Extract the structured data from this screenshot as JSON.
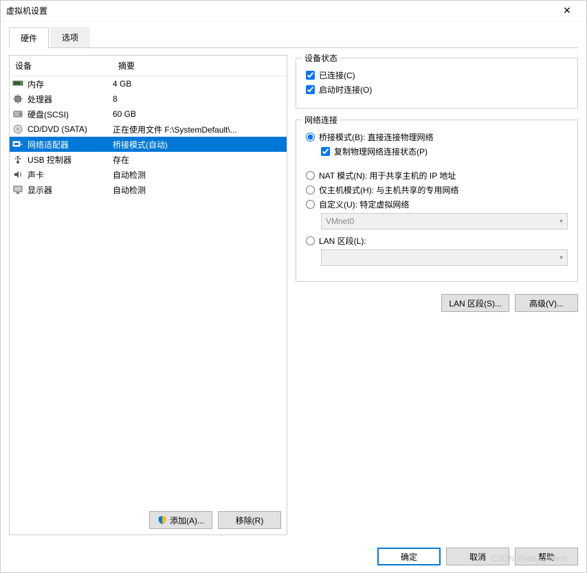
{
  "window": {
    "title": "虚拟机设置"
  },
  "tabs": {
    "hardware": "硬件",
    "options": "选项"
  },
  "table": {
    "header_device": "设备",
    "header_summary": "摘要",
    "rows": [
      {
        "icon": "memory",
        "name": "内存",
        "summary": "4 GB"
      },
      {
        "icon": "cpu",
        "name": "处理器",
        "summary": "8"
      },
      {
        "icon": "disk",
        "name": "硬盘(SCSI)",
        "summary": "60 GB"
      },
      {
        "icon": "cd",
        "name": "CD/DVD (SATA)",
        "summary": "正在使用文件 F:\\SystemDefault\\..."
      },
      {
        "icon": "net",
        "name": "网络适配器",
        "summary": "桥接模式(自动)",
        "selected": true
      },
      {
        "icon": "usb",
        "name": "USB 控制器",
        "summary": "存在"
      },
      {
        "icon": "sound",
        "name": "声卡",
        "summary": "自动检测"
      },
      {
        "icon": "display",
        "name": "显示器",
        "summary": "自动检测"
      }
    ]
  },
  "buttons": {
    "add": "添加(A)...",
    "remove": "移除(R)",
    "ok": "确定",
    "cancel": "取消",
    "help": "帮助",
    "lan_segments": "LAN 区段(S)...",
    "advanced": "高级(V)..."
  },
  "device_status": {
    "title": "设备状态",
    "connected": "已连接(C)",
    "connect_at_poweron": "启动时连接(O)"
  },
  "network": {
    "title": "网络连接",
    "bridged": "桥接模式(B): 直接连接物理网络",
    "replicate": "复制物理网络连接状态(P)",
    "nat": "NAT 模式(N): 用于共享主机的 IP 地址",
    "hostonly": "仅主机模式(H): 与主机共享的专用网络",
    "custom": "自定义(U): 特定虚拟网络",
    "custom_value": "VMnet0",
    "lan": "LAN 区段(L):",
    "lan_value": ""
  },
  "watermark": "CSDN @lady_killer9"
}
